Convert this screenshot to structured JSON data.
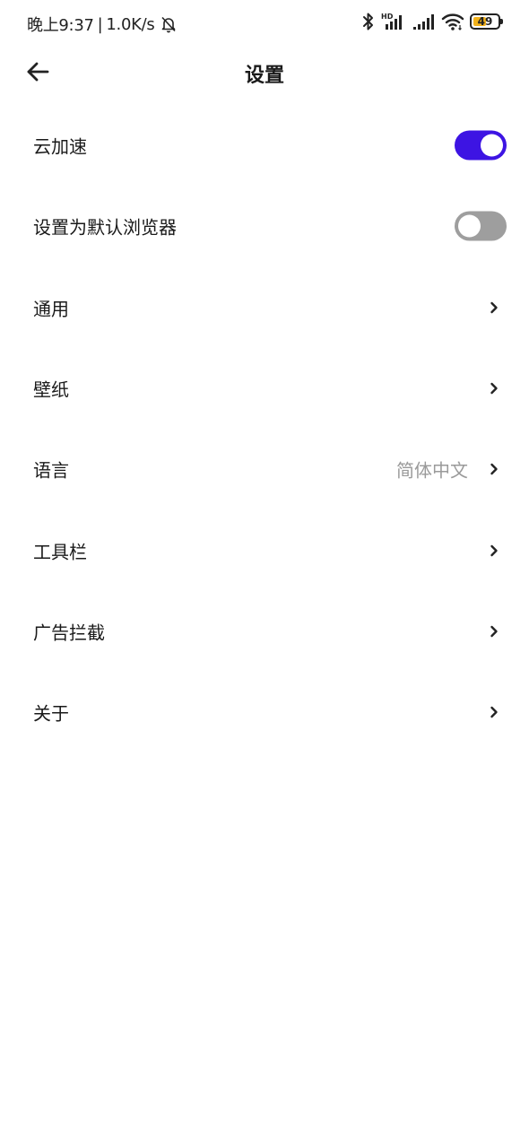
{
  "status_bar": {
    "time": "晚上9:37",
    "separator": "|",
    "net_speed": "1.0K/s",
    "battery_level": "49",
    "icons": [
      "bell-off-icon",
      "bluetooth-icon",
      "hd-signal-icon",
      "signal-icon",
      "wifi-icon",
      "battery-icon"
    ],
    "battery_color": "#f2b21b"
  },
  "header": {
    "back_icon": "arrow-left-icon",
    "title": "设置"
  },
  "settings": {
    "cloud_accel": {
      "label": "云加速",
      "enabled": true
    },
    "default_browser": {
      "label": "设置为默认浏览器",
      "enabled": false
    },
    "general": {
      "label": "通用"
    },
    "wallpaper": {
      "label": "壁纸"
    },
    "language": {
      "label": "语言",
      "value": "简体中文"
    },
    "toolbar": {
      "label": "工具栏"
    },
    "adblock": {
      "label": "广告拦截"
    },
    "about": {
      "label": "关于"
    }
  },
  "colors": {
    "toggle_on": "#3d14e3",
    "toggle_off": "#9e9e9e",
    "secondary_text": "#9a9a9a"
  }
}
